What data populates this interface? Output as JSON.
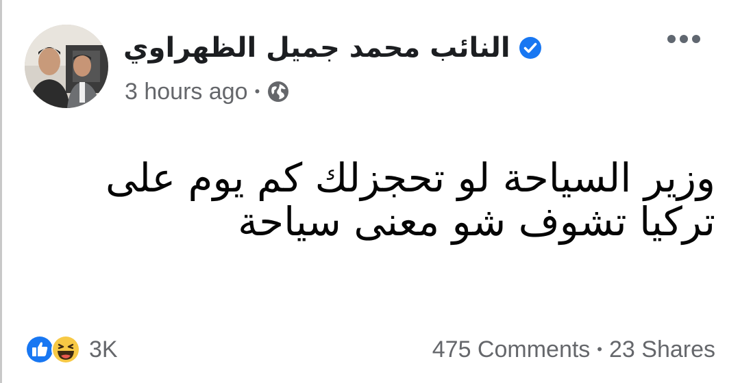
{
  "post": {
    "author": {
      "name": "النائب محمد جميل الظهراوي",
      "verified": true
    },
    "timestamp": "3 hours ago",
    "separator": "•",
    "privacy_icon": "globe-icon",
    "menu_icon": "more-options-icon",
    "text_lines": [
      "وزير السياحة  لو تحجزلك كم يوم على",
      "تركيا تشوف شو معنى سياحة"
    ]
  },
  "engagement": {
    "reaction_icons": [
      "like-icon",
      "haha-icon"
    ],
    "reaction_count": "3K",
    "comments": "475 Comments",
    "separator": "•",
    "shares": "23 Shares"
  },
  "colors": {
    "verified_blue": "#1877f2",
    "text_primary": "#050505",
    "text_secondary": "#65676b",
    "like_blue": "#1877f2",
    "haha_yellow": "#f7c945"
  }
}
